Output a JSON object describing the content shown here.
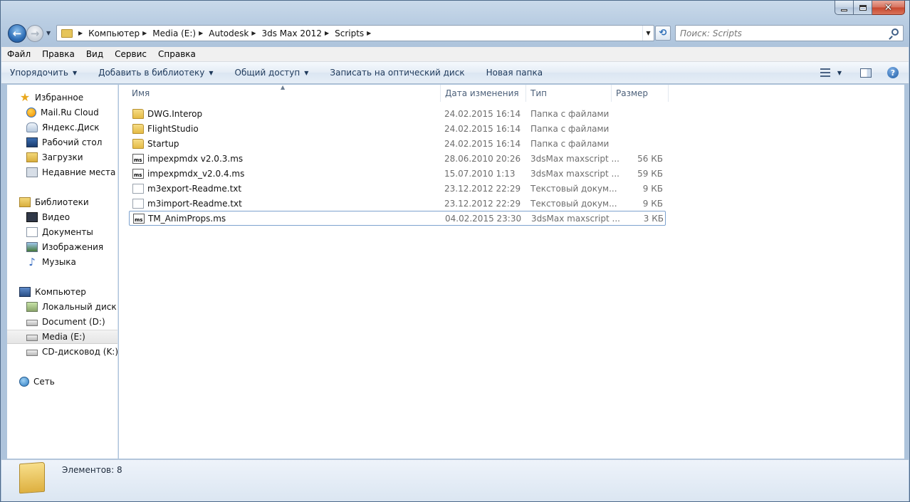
{
  "window": {
    "caption_buttons": [
      "minimize-icon",
      "maximize-icon",
      "close-icon"
    ],
    "close_glyph": "✕"
  },
  "nav": {
    "back_glyph": "←",
    "forward_glyph": "→",
    "refresh_glyph": "⟲"
  },
  "breadcrumb": [
    "Компьютер",
    "Media (E:)",
    "Autodesk",
    "3ds Max 2012",
    "Scripts"
  ],
  "search": {
    "placeholder": "Поиск: Scripts"
  },
  "menubar": [
    "Файл",
    "Правка",
    "Вид",
    "Сервис",
    "Справка"
  ],
  "commandbar": {
    "organize": "Упорядочить",
    "add_to_library": "Добавить в библиотеку",
    "share": "Общий доступ",
    "burn": "Записать на оптический диск",
    "new_folder": "Новая папка",
    "help_glyph": "?"
  },
  "navpane": {
    "favorites": {
      "label": "Избранное",
      "items": [
        "Mail.Ru Cloud",
        "Яндекс.Диск",
        "Рабочий стол",
        "Загрузки",
        "Недавние места"
      ]
    },
    "libraries": {
      "label": "Библиотеки",
      "items": [
        "Видео",
        "Документы",
        "Изображения",
        "Музыка"
      ]
    },
    "computer": {
      "label": "Компьютер",
      "items": [
        "Локальный диск (C",
        "Document (D:)",
        "Media (E:)",
        "CD-дисковод (K:)"
      ]
    },
    "network": {
      "label": "Сеть"
    }
  },
  "columns": {
    "name": "Имя",
    "date": "Дата изменения",
    "type": "Тип",
    "size": "Размер"
  },
  "files": [
    {
      "name": "DWG.Interop",
      "date": "24.02.2015 16:14",
      "type": "Папка с файлами",
      "size": "",
      "icon": "folder-icon"
    },
    {
      "name": "FlightStudio",
      "date": "24.02.2015 16:14",
      "type": "Папка с файлами",
      "size": "",
      "icon": "folder-icon"
    },
    {
      "name": "Startup",
      "date": "24.02.2015 16:14",
      "type": "Папка с файлами",
      "size": "",
      "icon": "folder-icon"
    },
    {
      "name": "impexpmdx v2.0.3.ms",
      "date": "28.06.2010 20:26",
      "type": "3dsMax maxscript ...",
      "size": "56 КБ",
      "icon": "maxscript-file-icon"
    },
    {
      "name": "impexpmdx_v2.0.4.ms",
      "date": "15.07.2010 1:13",
      "type": "3dsMax maxscript ...",
      "size": "59 КБ",
      "icon": "maxscript-file-icon"
    },
    {
      "name": "m3export-Readme.txt",
      "date": "23.12.2012 22:29",
      "type": "Текстовый докум...",
      "size": "9 КБ",
      "icon": "text-file-icon"
    },
    {
      "name": "m3import-Readme.txt",
      "date": "23.12.2012 22:29",
      "type": "Текстовый докум...",
      "size": "9 КБ",
      "icon": "text-file-icon"
    },
    {
      "name": "TM_AnimProps.ms",
      "date": "04.02.2015 23:30",
      "type": "3dsMax maxscript ...",
      "size": "3 КБ",
      "icon": "maxscript-file-icon"
    }
  ],
  "status": {
    "count_text": "Элементов: 8"
  }
}
